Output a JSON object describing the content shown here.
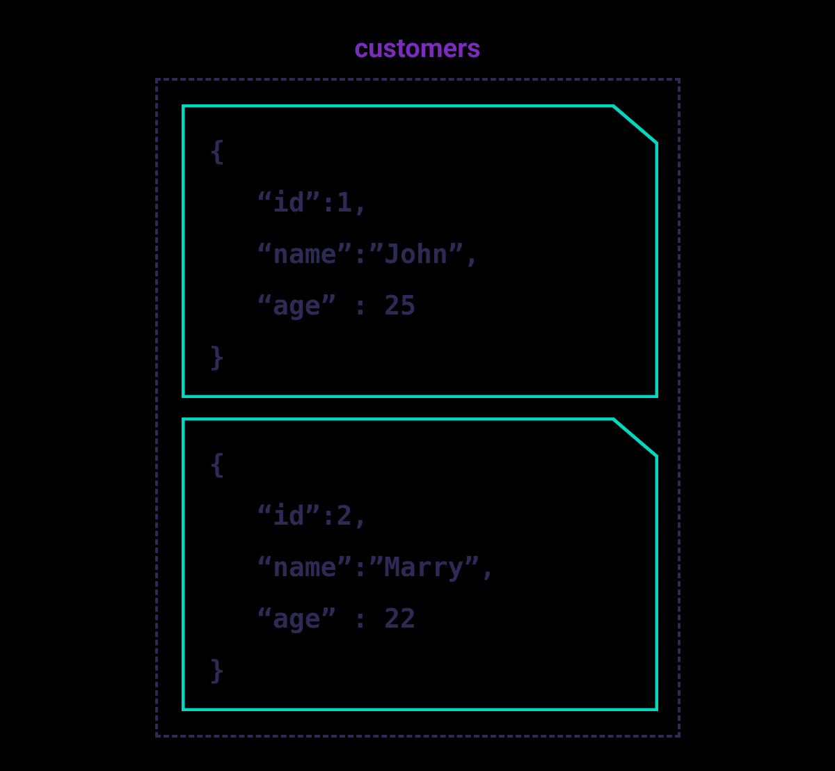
{
  "collection": {
    "title": "customers",
    "documents": [
      {
        "lines": [
          "{",
          "   “id”:1,",
          "   “name”:”John”,",
          "   “age” : 25",
          "}"
        ]
      },
      {
        "lines": [
          "{",
          "   “id”:2,",
          "   “name”:”Marry”,",
          "   “age” : 22",
          "}"
        ]
      }
    ]
  },
  "colors": {
    "title": "#7B2CBF",
    "border_dashed": "#2D2B55",
    "card_stroke": "#00D9C0",
    "text": "#2D2B55",
    "background": "#000000"
  }
}
